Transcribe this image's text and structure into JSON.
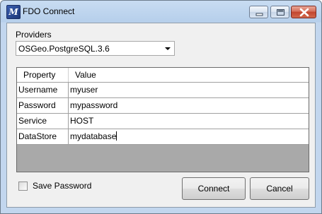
{
  "window": {
    "title": "FDO Connect",
    "icon": "fdo-app-icon",
    "controls": [
      "minimize-icon",
      "maximize-icon",
      "close-icon"
    ]
  },
  "providers": {
    "label": "Providers",
    "selected": "OSGeo.PostgreSQL.3.6"
  },
  "grid": {
    "columns": [
      "Property",
      "Value"
    ],
    "rows": [
      {
        "property": "Username",
        "value": "myuser"
      },
      {
        "property": "Password",
        "value": "mypassword"
      },
      {
        "property": "Service",
        "value": "HOST"
      },
      {
        "property": "DataStore",
        "value": "mydatabase"
      }
    ]
  },
  "options": {
    "save_password_label": "Save Password",
    "save_password_checked": false
  },
  "buttons": {
    "connect": "Connect",
    "cancel": "Cancel"
  }
}
